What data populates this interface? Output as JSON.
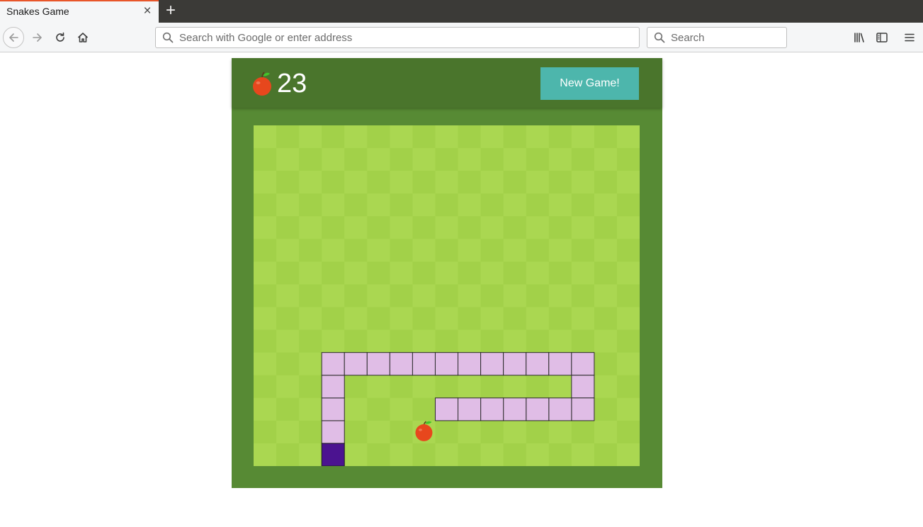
{
  "browser": {
    "tab_title": "Snakes Game",
    "close_tab_glyph": "×",
    "new_tab_glyph": "+",
    "url_placeholder": "Search with Google or enter address",
    "search_placeholder": "Search",
    "icons": [
      "back-icon",
      "forward-icon",
      "reload-icon",
      "home-icon",
      "library-icon",
      "sidebar-icon",
      "menu-icon"
    ]
  },
  "game": {
    "score": "23",
    "new_game_label": "New Game!",
    "colors": {
      "header": "#4a752c",
      "border": "#578a34",
      "tile_light": "#aad751",
      "tile_dark": "#a2d149",
      "snake_body": "#e0bde6",
      "snake_head": "#4b1390",
      "apple": "#e7471d",
      "button": "#4db6ac"
    },
    "board": {
      "cols": 17,
      "rows": 15,
      "snake_head": [
        3,
        14
      ],
      "snake_body": [
        [
          3,
          13
        ],
        [
          3,
          12
        ],
        [
          3,
          11
        ],
        [
          3,
          10
        ],
        [
          4,
          10
        ],
        [
          5,
          10
        ],
        [
          6,
          10
        ],
        [
          7,
          10
        ],
        [
          8,
          10
        ],
        [
          9,
          10
        ],
        [
          10,
          10
        ],
        [
          11,
          10
        ],
        [
          12,
          10
        ],
        [
          13,
          10
        ],
        [
          14,
          10
        ],
        [
          14,
          11
        ],
        [
          14,
          12
        ],
        [
          13,
          12
        ],
        [
          12,
          12
        ],
        [
          11,
          12
        ],
        [
          10,
          12
        ],
        [
          9,
          12
        ],
        [
          8,
          12
        ]
      ],
      "apple": [
        7,
        13
      ]
    }
  }
}
